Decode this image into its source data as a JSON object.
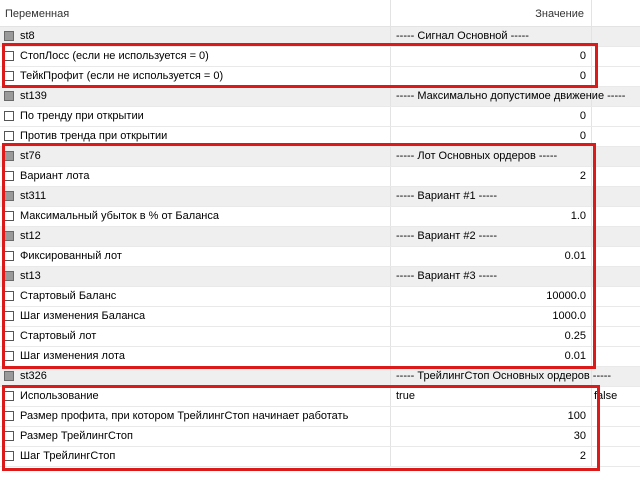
{
  "header": {
    "name_col": "Переменная",
    "value_col": "Значение"
  },
  "rows": [
    {
      "kind": "group",
      "name": "st8",
      "value": "----- Сигнал Основной -----"
    },
    {
      "kind": "param",
      "name": "СтопЛосс (если не используется = 0)",
      "value": "0"
    },
    {
      "kind": "param",
      "name": "ТейкПрофит (если не используется = 0)",
      "value": "0"
    },
    {
      "kind": "group",
      "name": "st139",
      "value": "----- Максимально допустимое движение -----"
    },
    {
      "kind": "param",
      "name": "По тренду при открытии",
      "value": "0"
    },
    {
      "kind": "param",
      "name": "Против тренда при открытии",
      "value": "0"
    },
    {
      "kind": "group",
      "name": "st76",
      "value": "----- Лот Основных ордеров -----"
    },
    {
      "kind": "param",
      "name": "Вариант лота",
      "value": "2"
    },
    {
      "kind": "group",
      "name": "st311",
      "value": "----- Вариант #1 -----"
    },
    {
      "kind": "param",
      "name": "Максимальный убыток в % от Баланса",
      "value": "1.0"
    },
    {
      "kind": "group",
      "name": "st12",
      "value": "----- Вариант #2 -----"
    },
    {
      "kind": "param",
      "name": "Фиксированный лот",
      "value": "0.01"
    },
    {
      "kind": "group",
      "name": "st13",
      "value": "----- Вариант #3 -----"
    },
    {
      "kind": "param",
      "name": "Стартовый Баланс",
      "value": "10000.0"
    },
    {
      "kind": "param",
      "name": "Шаг изменения Баланса",
      "value": "1000.0"
    },
    {
      "kind": "param",
      "name": "Стартовый лот",
      "value": "0.25"
    },
    {
      "kind": "param",
      "name": "Шаг изменения лота",
      "value": "0.01"
    },
    {
      "kind": "group",
      "name": "st326",
      "value": "----- ТрейлингСтоп Основных ордеров -----"
    },
    {
      "kind": "bool",
      "name": "Использование",
      "value": "true",
      "extra": "false"
    },
    {
      "kind": "param",
      "name": "Размер профита, при котором ТрейлингСтоп начинает работать",
      "value": "100"
    },
    {
      "kind": "param",
      "name": "Размер ТрейлингСтоп",
      "value": "30"
    },
    {
      "kind": "param",
      "name": "Шаг ТрейлингСтоп",
      "value": "2"
    }
  ],
  "highlight_color": "#dd1a1a"
}
